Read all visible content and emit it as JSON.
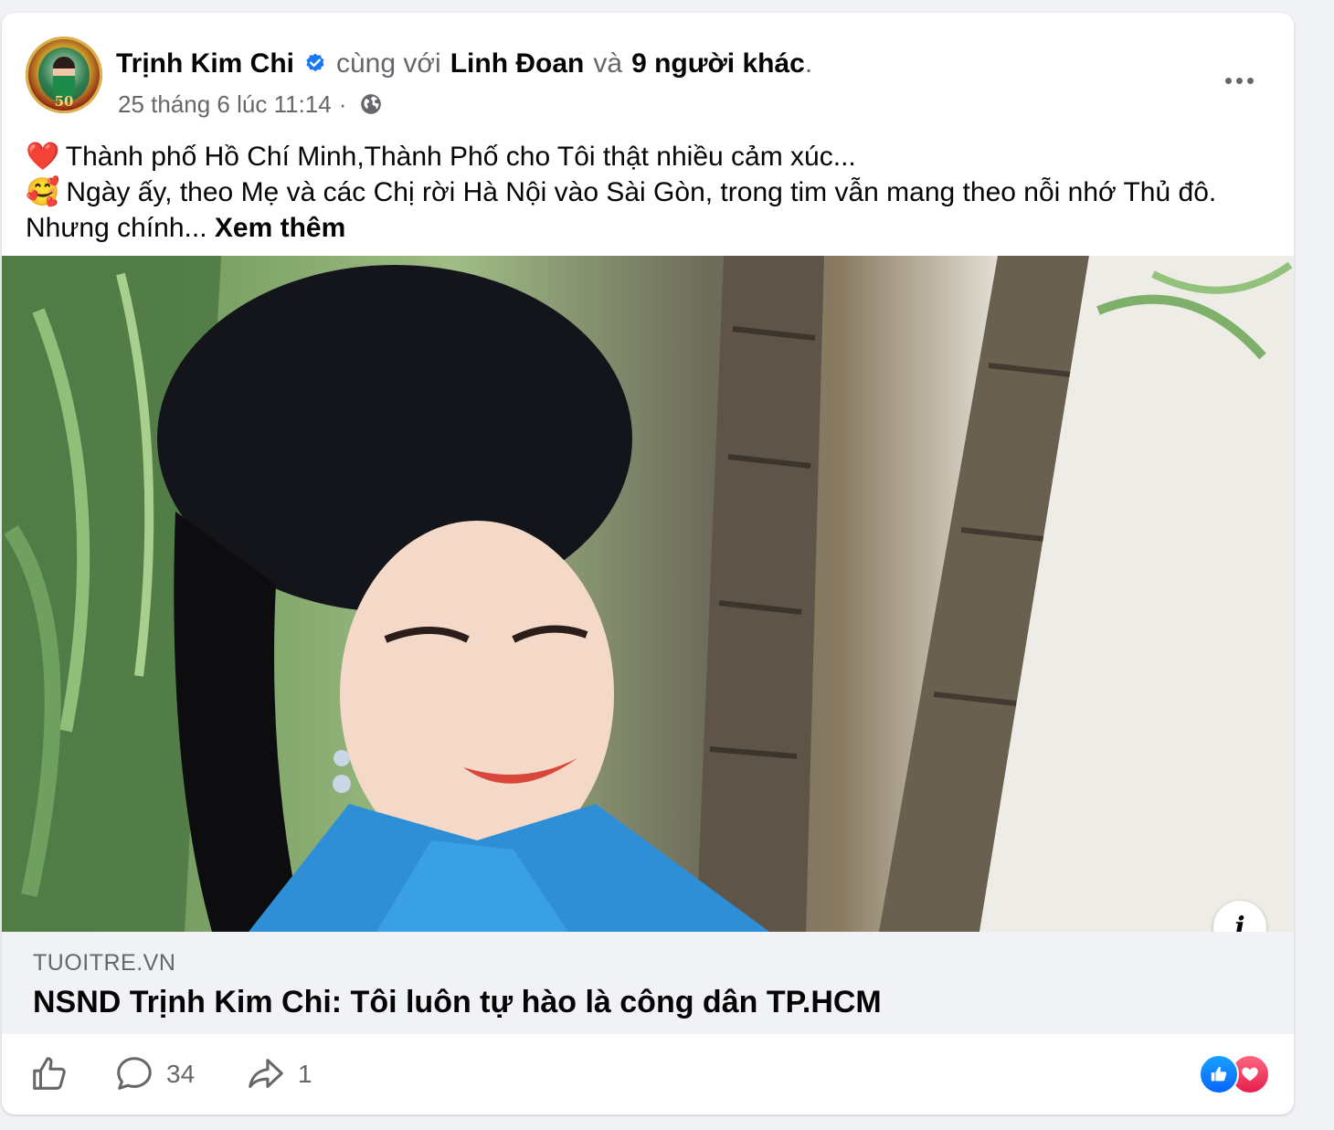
{
  "post": {
    "author": "Trịnh Kim Chi",
    "with_text": "cùng với",
    "tagged_person": "Linh Đoan",
    "and_text": "và",
    "others": "9 người khác",
    "period": ".",
    "timestamp": "25 tháng 6 lúc 11:14",
    "separator": "·",
    "avatar_badge": "50",
    "text_line1": "Thành phố Hồ Chí Minh,Thành Phố cho Tôi thật nhiều cảm xúc...",
    "text_line2": "Ngày ấy, theo Mẹ và các Chị rời Hà Nội vào Sài Gòn, trong tim vẫn mang theo nỗi nhớ Thủ đô. Nhưng chính...",
    "see_more": "Xem thêm",
    "emoji1": "❤️",
    "emoji2": "🥰"
  },
  "link": {
    "domain": "TUOITRE.VN",
    "title": "NSND Trịnh Kim Chi: Tôi luôn tự hào là công dân TP.HCM",
    "info_label": "i"
  },
  "actions": {
    "comment_count": "34",
    "share_count": "1"
  },
  "icons": {
    "verified": "verified-badge-icon",
    "globe": "globe-icon",
    "more": "more-options-icon",
    "like": "thumbs-up-icon",
    "comment": "comment-bubble-icon",
    "share": "share-arrow-icon",
    "info": "info-icon"
  },
  "colors": {
    "verified_blue": "#1877f2",
    "muted_text": "#65676b",
    "like_blue": "#0766ff",
    "love_red": "#e61e4d"
  }
}
